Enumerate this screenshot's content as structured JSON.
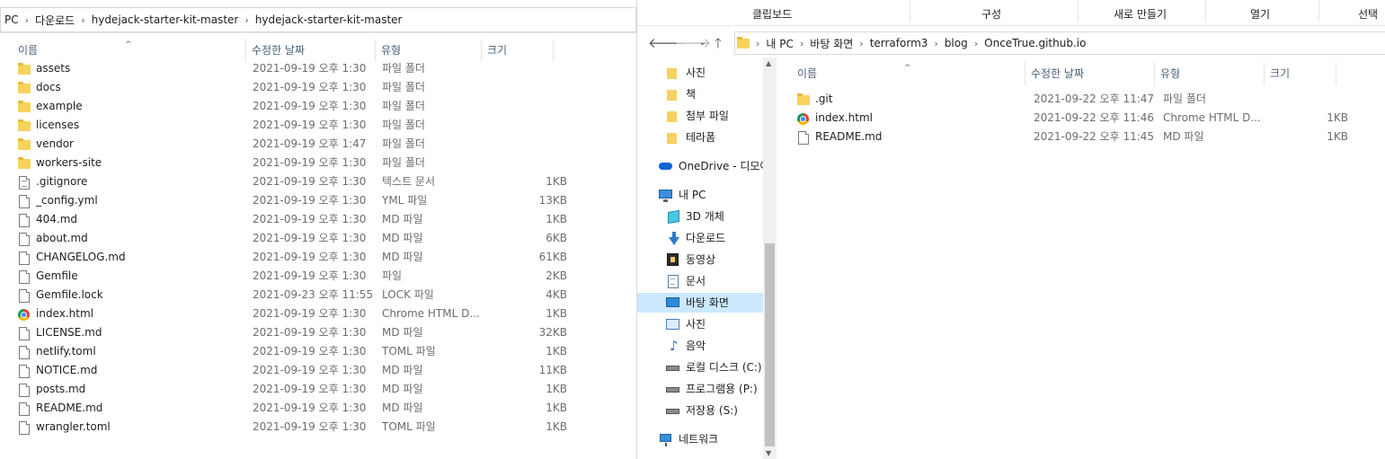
{
  "left": {
    "breadcrumb": [
      "PC",
      "다운로드",
      "hydejack-starter-kit-master",
      "hydejack-starter-kit-master"
    ],
    "columns": {
      "name": "이름",
      "date": "수정한 날짜",
      "type": "유형",
      "size": "크기"
    },
    "files": [
      {
        "name": "assets",
        "date": "2021-09-19 오후 1:30",
        "type": "파일 폴더",
        "size": "",
        "icon": "folder-icon"
      },
      {
        "name": "docs",
        "date": "2021-09-19 오후 1:30",
        "type": "파일 폴더",
        "size": "",
        "icon": "folder-icon"
      },
      {
        "name": "example",
        "date": "2021-09-19 오후 1:30",
        "type": "파일 폴더",
        "size": "",
        "icon": "folder-icon"
      },
      {
        "name": "licenses",
        "date": "2021-09-19 오후 1:30",
        "type": "파일 폴더",
        "size": "",
        "icon": "folder-icon"
      },
      {
        "name": "vendor",
        "date": "2021-09-19 오후 1:47",
        "type": "파일 폴더",
        "size": "",
        "icon": "folder-icon"
      },
      {
        "name": "workers-site",
        "date": "2021-09-19 오후 1:30",
        "type": "파일 폴더",
        "size": "",
        "icon": "folder-icon"
      },
      {
        "name": ".gitignore",
        "date": "2021-09-19 오후 1:30",
        "type": "텍스트 문서",
        "size": "1KB",
        "icon": "text-file-icon"
      },
      {
        "name": "_config.yml",
        "date": "2021-09-19 오후 1:30",
        "type": "YML 파일",
        "size": "13KB",
        "icon": "file-icon"
      },
      {
        "name": "404.md",
        "date": "2021-09-19 오후 1:30",
        "type": "MD 파일",
        "size": "1KB",
        "icon": "file-icon"
      },
      {
        "name": "about.md",
        "date": "2021-09-19 오후 1:30",
        "type": "MD 파일",
        "size": "6KB",
        "icon": "file-icon"
      },
      {
        "name": "CHANGELOG.md",
        "date": "2021-09-19 오후 1:30",
        "type": "MD 파일",
        "size": "61KB",
        "icon": "file-icon"
      },
      {
        "name": "Gemfile",
        "date": "2021-09-19 오후 1:30",
        "type": "파일",
        "size": "2KB",
        "icon": "file-icon"
      },
      {
        "name": "Gemfile.lock",
        "date": "2021-09-23 오후 11:55",
        "type": "LOCK 파일",
        "size": "4KB",
        "icon": "file-icon"
      },
      {
        "name": "index.html",
        "date": "2021-09-19 오후 1:30",
        "type": "Chrome HTML D...",
        "size": "1KB",
        "icon": "chrome-icon"
      },
      {
        "name": "LICENSE.md",
        "date": "2021-09-19 오후 1:30",
        "type": "MD 파일",
        "size": "32KB",
        "icon": "file-icon"
      },
      {
        "name": "netlify.toml",
        "date": "2021-09-19 오후 1:30",
        "type": "TOML 파일",
        "size": "1KB",
        "icon": "file-icon"
      },
      {
        "name": "NOTICE.md",
        "date": "2021-09-19 오후 1:30",
        "type": "MD 파일",
        "size": "11KB",
        "icon": "file-icon"
      },
      {
        "name": "posts.md",
        "date": "2021-09-19 오후 1:30",
        "type": "MD 파일",
        "size": "1KB",
        "icon": "file-icon"
      },
      {
        "name": "README.md",
        "date": "2021-09-19 오후 1:30",
        "type": "MD 파일",
        "size": "1KB",
        "icon": "file-icon"
      },
      {
        "name": "wrangler.toml",
        "date": "2021-09-19 오후 1:30",
        "type": "TOML 파일",
        "size": "1KB",
        "icon": "file-icon"
      }
    ]
  },
  "right": {
    "ribbon": [
      "클립보드",
      "구성",
      "새로 만들기",
      "열기",
      "선택"
    ],
    "nav": {
      "back": "🡐",
      "forward": "🡒",
      "recent": "⌄",
      "up": "🡑"
    },
    "breadcrumb": [
      "내 PC",
      "바탕 화면",
      "terraform3",
      "blog",
      "OnceTrue.github.io"
    ],
    "columns": {
      "name": "이름",
      "date": "수정한 날짜",
      "type": "유형",
      "size": "크기"
    },
    "files": [
      {
        "name": ".git",
        "date": "2021-09-22 오후 11:47",
        "type": "파일 폴더",
        "size": "",
        "icon": "folder-icon"
      },
      {
        "name": "index.html",
        "date": "2021-09-22 오후 11:46",
        "type": "Chrome HTML D...",
        "size": "1KB",
        "icon": "chrome-icon"
      },
      {
        "name": "README.md",
        "date": "2021-09-22 오후 11:45",
        "type": "MD 파일",
        "size": "1KB",
        "icon": "file-icon"
      }
    ],
    "navpane": [
      {
        "label": "사진",
        "icon": "folder-icon",
        "level": 1
      },
      {
        "label": "책",
        "icon": "folder-icon",
        "level": 1
      },
      {
        "label": "첨부 파일",
        "icon": "folder-icon",
        "level": 1
      },
      {
        "label": "테라폼",
        "icon": "folder-icon",
        "level": 1
      },
      {
        "label": "OneDrive - 디모아",
        "icon": "onedrive-icon",
        "level": 0
      },
      {
        "label": "내 PC",
        "icon": "pc-icon",
        "level": 0
      },
      {
        "label": "3D 개체",
        "icon": "3d-objects-icon",
        "level": 1
      },
      {
        "label": "다운로드",
        "icon": "download-icon",
        "level": 1
      },
      {
        "label": "동영상",
        "icon": "video-icon",
        "level": 1
      },
      {
        "label": "문서",
        "icon": "document-icon",
        "level": 1
      },
      {
        "label": "바탕 화면",
        "icon": "desktop-icon",
        "level": 1,
        "selected": true
      },
      {
        "label": "사진",
        "icon": "pictures-icon",
        "level": 1
      },
      {
        "label": "음악",
        "icon": "music-icon",
        "level": 1
      },
      {
        "label": "로컬 디스크 (C:)",
        "icon": "local-disk-icon",
        "level": 1
      },
      {
        "label": "프로그램용 (P:)",
        "icon": "drive-icon",
        "level": 1
      },
      {
        "label": "저장용 (S:)",
        "icon": "drive-icon",
        "level": 1
      },
      {
        "label": "네트워크",
        "icon": "network-icon",
        "level": 0
      }
    ]
  }
}
